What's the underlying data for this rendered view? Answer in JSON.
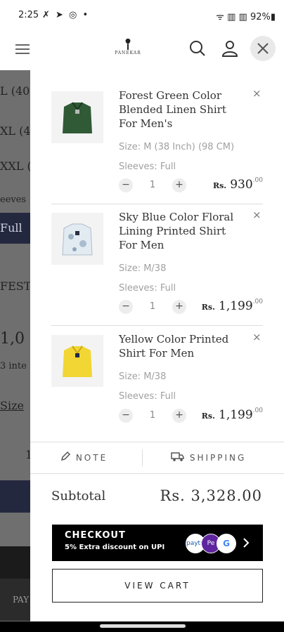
{
  "status_bar": {
    "time": "2:25",
    "icons": "✗ ➤ ◎ •",
    "right": "ᯤ ▥ ▥ 92%▮"
  },
  "header": {
    "logo_text": "PANEKAR"
  },
  "background_page": {
    "lines": [
      "L (40",
      "XL (4",
      "XXL (",
      "eeves",
      "Full",
      "FEST",
      "1,0",
      "3 inte",
      "Size",
      "1",
      "PAY"
    ]
  },
  "cart": {
    "items": [
      {
        "name": "Forest Green Color Blended Linen Shirt For Men's",
        "size": "Size: M (38 Inch) (98 CM)",
        "sleeves": "Sleeves: Full",
        "qty": "1",
        "currency": "Rs.",
        "amount": "930",
        "decimals": ".00",
        "remove": "×",
        "minus": "−",
        "plus": "+",
        "color": "#2f5a35"
      },
      {
        "name": "Sky Blue Color Floral Lining Printed Shirt For Men",
        "size": "Size: M/38",
        "sleeves": "Sleeves: Full",
        "qty": "1",
        "currency": "Rs.",
        "amount": "1,199",
        "decimals": ".00",
        "remove": "×",
        "minus": "−",
        "plus": "+",
        "color": "#dfe8ef"
      },
      {
        "name": "Yellow Color Printed Shirt For Men",
        "size": "Size: M/38",
        "sleeves": "Sleeves: Full",
        "qty": "1",
        "currency": "Rs.",
        "amount": "1,199",
        "decimals": ".00",
        "remove": "×",
        "minus": "−",
        "plus": "+",
        "color": "#f1d634"
      }
    ],
    "note_label": "NOTE",
    "shipping_label": "SHIPPING",
    "subtotal_label": "Subtotal",
    "subtotal_value": "Rs. 3,328.00",
    "checkout_title": "CHECKOUT",
    "checkout_sub": "5% Extra discount on UPI",
    "pay_icons": [
      "paytm",
      "Pe",
      "G"
    ],
    "view_cart": "VIEW CART"
  }
}
